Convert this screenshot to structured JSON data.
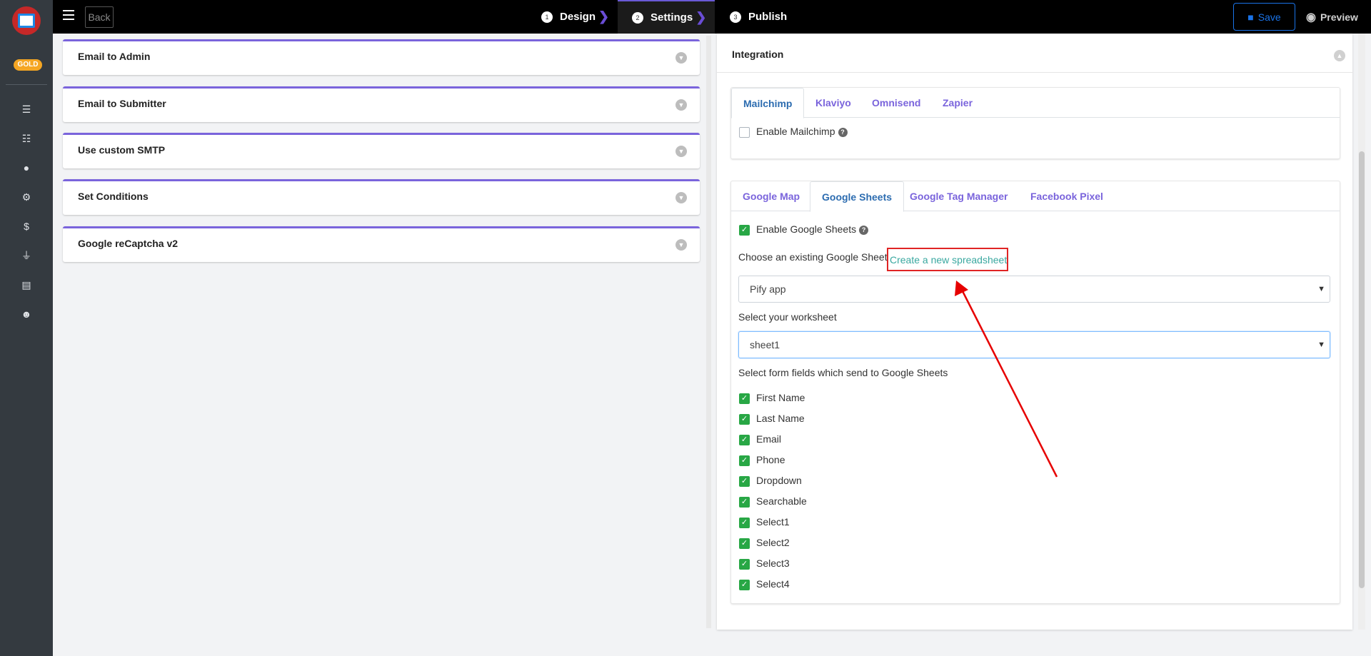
{
  "sidebar": {
    "badge": "GOLD",
    "icons": [
      "list-icon",
      "tasks-icon",
      "user-icon",
      "gear-icon",
      "dollar-icon",
      "plug-icon",
      "file-icon",
      "smiley-icon"
    ]
  },
  "topbar": {
    "back_label": "Back",
    "steps": [
      {
        "num": "1",
        "label": "Design"
      },
      {
        "num": "2",
        "label": "Settings"
      },
      {
        "num": "3",
        "label": "Publish"
      }
    ],
    "save_label": "Save",
    "preview_label": "Preview"
  },
  "left": {
    "sections": [
      "Email to Admin",
      "Email to Submitter",
      "Use custom SMTP",
      "Set Conditions",
      "Google reCaptcha v2"
    ]
  },
  "integration": {
    "title": "Integration",
    "email_tabs": [
      "Mailchimp",
      "Klaviyo",
      "Omnisend",
      "Zapier"
    ],
    "enable_mailchimp": "Enable Mailchimp",
    "other_tabs": [
      "Google Map",
      "Google Sheets",
      "Google Tag Manager",
      "Facebook Pixel"
    ],
    "enable_sheets": "Enable Google Sheets",
    "choose_label": "Choose an existing Google Sheet",
    "create_link": "Create a new spreadsheet",
    "sheet_value": "Pify app",
    "worksheet_label": "Select your worksheet",
    "worksheet_value": "sheet1",
    "fields_label": "Select form fields which send to Google Sheets",
    "fields": [
      "First Name",
      "Last Name",
      "Email",
      "Phone",
      "Dropdown",
      "Searchable",
      "Select1",
      "Select2",
      "Select3",
      "Select4"
    ]
  },
  "colors": {
    "accent": "#7a64dc",
    "sidebar": "#343a40",
    "checkbox": "#28a745",
    "highlight": "#e02424",
    "link": "#3aa8a0"
  }
}
